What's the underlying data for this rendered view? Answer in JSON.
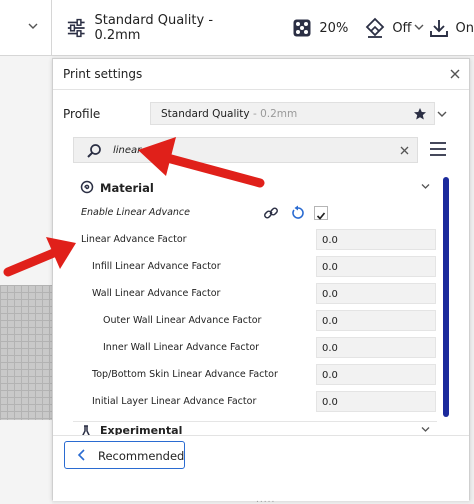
{
  "topbar": {
    "quality_label": "Standard Quality - 0.2mm",
    "infill_value": "20%",
    "support_value": "Off",
    "adhesion_value": "On"
  },
  "panel": {
    "title": "Print settings",
    "profile_label": "Profile",
    "profile_name": "Standard Quality",
    "profile_sub": " - 0.2mm",
    "search_value": "linear"
  },
  "category": {
    "label": "Material"
  },
  "rows": [
    {
      "label": "Enable Linear Advance",
      "checked": true
    },
    {
      "label": "Linear Advance Factor",
      "value": "0.0"
    },
    {
      "label": "Infill Linear Advance Factor",
      "value": "0.0"
    },
    {
      "label": "Wall Linear Advance Factor",
      "value": "0.0"
    },
    {
      "label": "Outer Wall Linear Advance Factor",
      "value": "0.0"
    },
    {
      "label": "Inner Wall Linear Advance Factor",
      "value": "0.0"
    },
    {
      "label": "Top/Bottom Skin Linear Advance Factor",
      "value": "0.0"
    },
    {
      "label": "Initial Layer Linear Advance Factor",
      "value": "0.0"
    }
  ],
  "next_category": {
    "label": "Experimental"
  },
  "footer": {
    "recommended_label": "Recommended"
  },
  "colors": {
    "accent": "#2a6bd1",
    "scrollbar": "#1b2a9c",
    "annotation": "#e0201a"
  }
}
